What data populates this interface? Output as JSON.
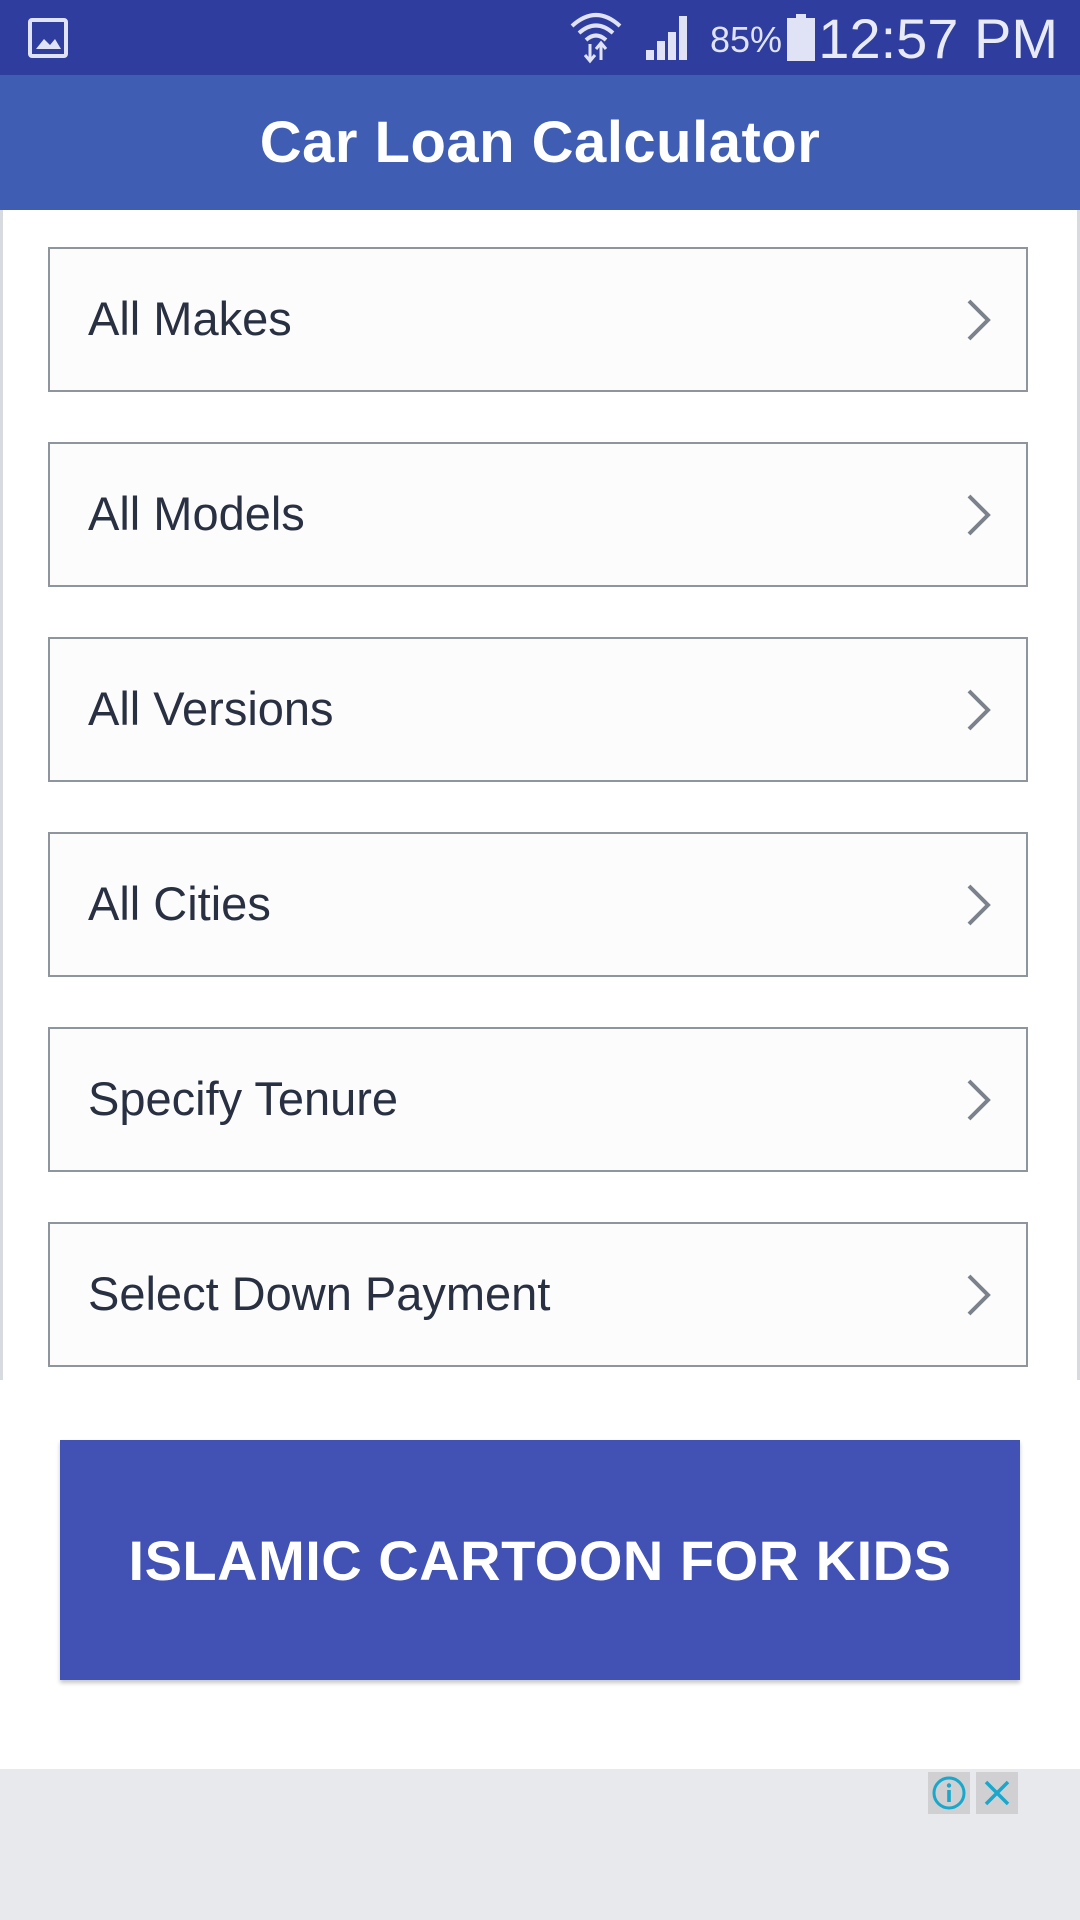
{
  "status_bar": {
    "battery_percent": "85%",
    "time": "12:57 PM",
    "icons": [
      "gallery-icon",
      "wifi-icon",
      "signal-icon",
      "battery-icon"
    ]
  },
  "header": {
    "title": "Car Loan Calculator"
  },
  "options": [
    {
      "label": "All Makes"
    },
    {
      "label": "All Models"
    },
    {
      "label": "All Versions"
    },
    {
      "label": "All Cities"
    },
    {
      "label": "Specify Tenure"
    },
    {
      "label": "Select Down Payment"
    }
  ],
  "promo": {
    "label": "ISLAMIC CARTOON FOR KIDS"
  },
  "ad": {
    "icons": [
      "ad-info-icon",
      "ad-close-icon"
    ]
  },
  "colors": {
    "status_bar": "#2f3e9e",
    "app_header": "#3f5db2",
    "promo_button": "#4152b4",
    "row_border": "#8e959c",
    "ad_icon_accent": "#19a7cc"
  }
}
